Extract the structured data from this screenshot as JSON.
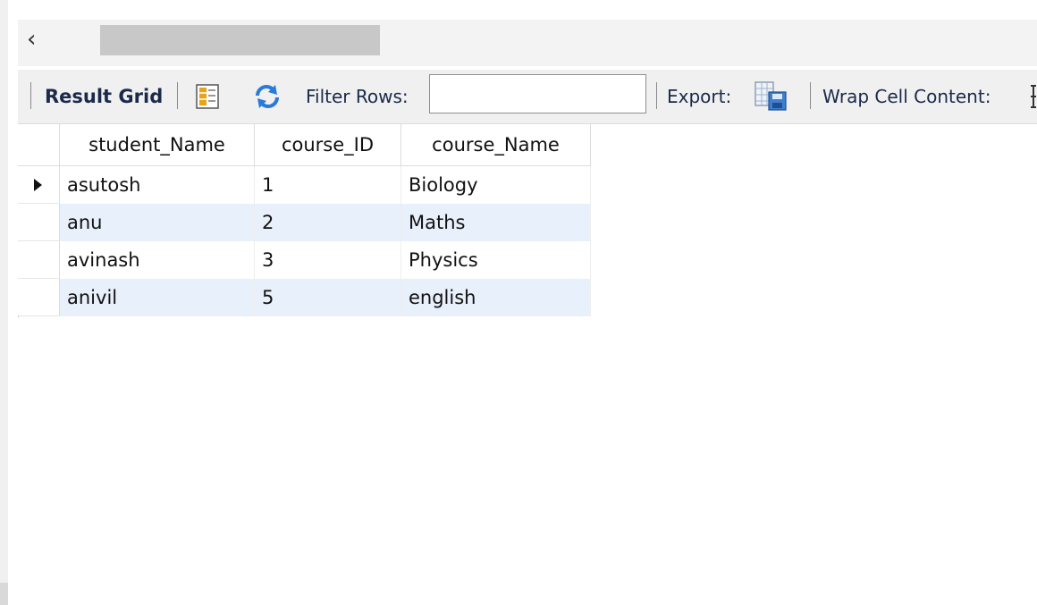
{
  "toolbar": {
    "result_grid_label": "Result Grid",
    "filter_label": "Filter Rows:",
    "filter_value": "",
    "export_label": "Export:",
    "wrap_label": "Wrap Cell Content:"
  },
  "icons": {
    "back": "chevron-left-icon",
    "form_editor": "form-editor-icon",
    "refresh": "refresh-icon",
    "export": "export-icon"
  },
  "colors": {
    "accent_blue": "#2a7ad8",
    "alt_row": "#e8f0fb",
    "grid_icon_orange": "#e8a317"
  },
  "grid": {
    "headers": [
      "student_Name",
      "course_ID",
      "course_Name"
    ],
    "rows": [
      [
        "asutosh",
        "1",
        "Biology"
      ],
      [
        "anu",
        "2",
        "Maths"
      ],
      [
        "avinash",
        "3",
        "Physics"
      ],
      [
        "anivil",
        "5",
        "english"
      ]
    ]
  }
}
